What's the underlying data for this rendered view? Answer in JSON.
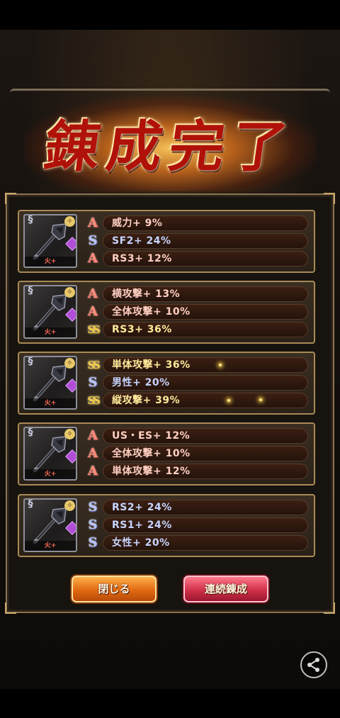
{
  "title": "錬成完了",
  "cards": [
    {
      "element_label": "火+",
      "effects": [
        {
          "rank": "A",
          "text": "威力+ 9%"
        },
        {
          "rank": "S",
          "text": "SF2+ 24%"
        },
        {
          "rank": "A",
          "text": "RS3+ 12%"
        }
      ]
    },
    {
      "element_label": "火+",
      "effects": [
        {
          "rank": "A",
          "text": "横攻撃+ 13%"
        },
        {
          "rank": "A",
          "text": "全体攻撃+ 10%"
        },
        {
          "rank": "SS",
          "text": "RS3+ 36%"
        }
      ]
    },
    {
      "element_label": "火+",
      "effects": [
        {
          "rank": "SS",
          "text": "単体攻撃+ 36%"
        },
        {
          "rank": "S",
          "text": "男性+ 20%"
        },
        {
          "rank": "SS",
          "text": "縦攻撃+ 39%"
        }
      ]
    },
    {
      "element_label": "火+",
      "effects": [
        {
          "rank": "A",
          "text": "US・ES+ 12%"
        },
        {
          "rank": "A",
          "text": "全体攻撃+ 10%"
        },
        {
          "rank": "A",
          "text": "単体攻撃+ 12%"
        }
      ]
    },
    {
      "element_label": "火+",
      "effects": [
        {
          "rank": "S",
          "text": "RS2+ 24%"
        },
        {
          "rank": "S",
          "text": "RS1+ 24%"
        },
        {
          "rank": "S",
          "text": "女性+ 20%"
        }
      ]
    }
  ],
  "buttons": {
    "close": "閉じる",
    "repeat": "連続錬成"
  },
  "icons": {
    "weapon": "axe-icon",
    "share": "share-icon"
  },
  "colors": {
    "rank_A": "#ff8a7a",
    "rank_S": "#b9c6ff",
    "rank_SS": "#f2c94c",
    "title_red": "#b0120a"
  }
}
